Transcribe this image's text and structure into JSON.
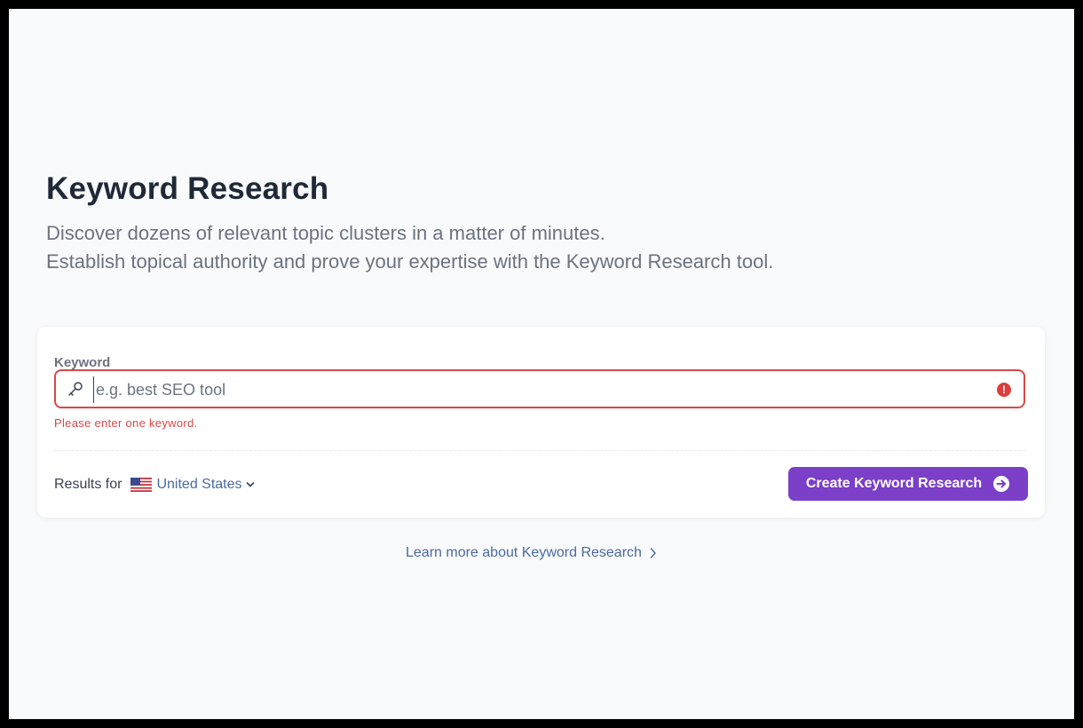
{
  "header": {
    "title": "Keyword Research",
    "subtitle_line1": "Discover dozens of relevant topic clusters in a matter of minutes.",
    "subtitle_line2": "Establish topical authority and prove your expertise with the Keyword Research tool."
  },
  "form": {
    "keyword_label": "Keyword",
    "keyword_value": "",
    "keyword_placeholder": "e.g. best SEO tool",
    "error_message": "Please enter one keyword.",
    "results_for_label": "Results for",
    "country": "United States",
    "submit_label": "Create Keyword Research"
  },
  "footer": {
    "learn_more_label": "Learn more about Keyword Research"
  },
  "colors": {
    "accent": "#7b3fc8",
    "error": "#d94848",
    "link": "#4a6aa0"
  },
  "icons": [
    "key-icon",
    "error-icon",
    "us-flag-icon",
    "chevron-down-icon",
    "arrow-circle-right-icon",
    "chevron-right-icon"
  ]
}
